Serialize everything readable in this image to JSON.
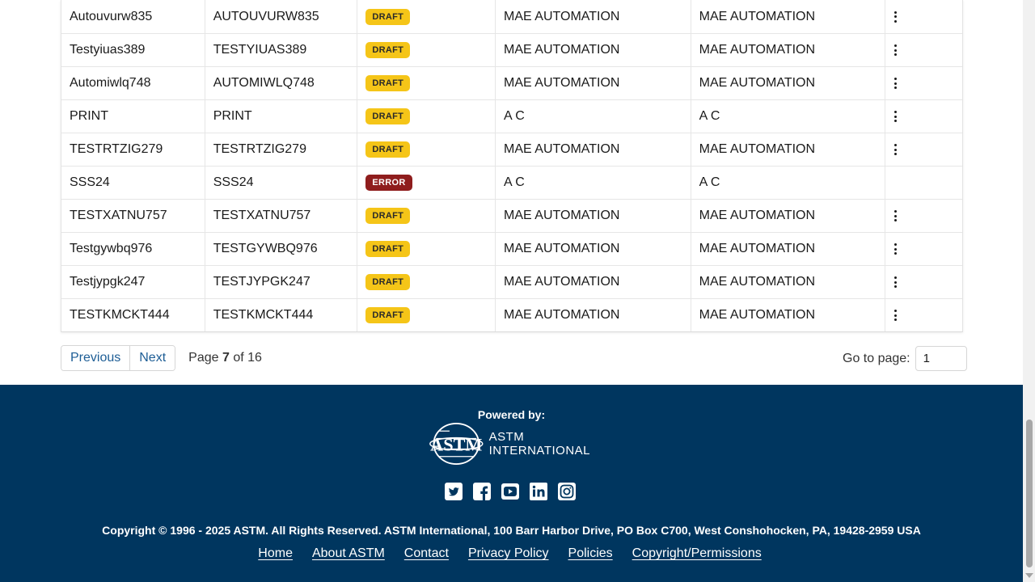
{
  "table": {
    "rows": [
      {
        "name": "Autouvurw835",
        "code": "AUTOUVURW835",
        "status": "DRAFT",
        "status_type": "draft",
        "created_by": "MAE AUTOMATION",
        "modified_by": "MAE AUTOMATION",
        "has_menu": true
      },
      {
        "name": "Testyiuas389",
        "code": "TESTYIUAS389",
        "status": "DRAFT",
        "status_type": "draft",
        "created_by": "MAE AUTOMATION",
        "modified_by": "MAE AUTOMATION",
        "has_menu": true
      },
      {
        "name": "Automiwlq748",
        "code": "AUTOMIWLQ748",
        "status": "DRAFT",
        "status_type": "draft",
        "created_by": "MAE AUTOMATION",
        "modified_by": "MAE AUTOMATION",
        "has_menu": true
      },
      {
        "name": "PRINT",
        "code": "PRINT",
        "status": "DRAFT",
        "status_type": "draft",
        "created_by": "A C",
        "modified_by": "A C",
        "has_menu": true
      },
      {
        "name": "TESTRTZIG279",
        "code": "TESTRTZIG279",
        "status": "DRAFT",
        "status_type": "draft",
        "created_by": "MAE AUTOMATION",
        "modified_by": "MAE AUTOMATION",
        "has_menu": true
      },
      {
        "name": "SSS24",
        "code": "SSS24",
        "status": "ERROR",
        "status_type": "error",
        "created_by": "A C",
        "modified_by": "A C",
        "has_menu": false
      },
      {
        "name": "TESTXATNU757",
        "code": "TESTXATNU757",
        "status": "DRAFT",
        "status_type": "draft",
        "created_by": "MAE AUTOMATION",
        "modified_by": "MAE AUTOMATION",
        "has_menu": true
      },
      {
        "name": "Testgywbq976",
        "code": "TESTGYWBQ976",
        "status": "DRAFT",
        "status_type": "draft",
        "created_by": "MAE AUTOMATION",
        "modified_by": "MAE AUTOMATION",
        "has_menu": true
      },
      {
        "name": "Testjypgk247",
        "code": "TESTJYPGK247",
        "status": "DRAFT",
        "status_type": "draft",
        "created_by": "MAE AUTOMATION",
        "modified_by": "MAE AUTOMATION",
        "has_menu": true
      },
      {
        "name": "TESTKMCKT444",
        "code": "TESTKMCKT444",
        "status": "DRAFT",
        "status_type": "draft",
        "created_by": "MAE AUTOMATION",
        "modified_by": "MAE AUTOMATION",
        "has_menu": true
      }
    ]
  },
  "pagination": {
    "previous_label": "Previous",
    "next_label": "Next",
    "page_prefix": "Page",
    "current_page": "7",
    "page_of": "of 16",
    "goto_label": "Go to page:",
    "goto_value": "1"
  },
  "footer": {
    "powered_by": "Powered by:",
    "logo_line1": "ASTM",
    "logo_line2": "INTERNATIONAL",
    "logo_mark_text": "ASTM",
    "social_icons": [
      "twitter-icon",
      "facebook-icon",
      "youtube-icon",
      "linkedin-icon",
      "instagram-icon"
    ],
    "copyright": "Copyright © 1996 - 2025 ASTM. All Rights Reserved. ASTM International, 100 Barr Harbor Drive, PO Box C700, West Conshohocken, PA, 19428-2959 USA",
    "links": {
      "home": "Home",
      "about": "About ASTM",
      "contact": "Contact",
      "privacy": "Privacy Policy",
      "policies": "Policies",
      "copyright": "Copyright/Permissions"
    }
  },
  "colors": {
    "footer_bg": "#00365f",
    "draft_badge": "#f5c518",
    "error_badge": "#8f1d1d",
    "link_blue": "#1d5d95"
  }
}
